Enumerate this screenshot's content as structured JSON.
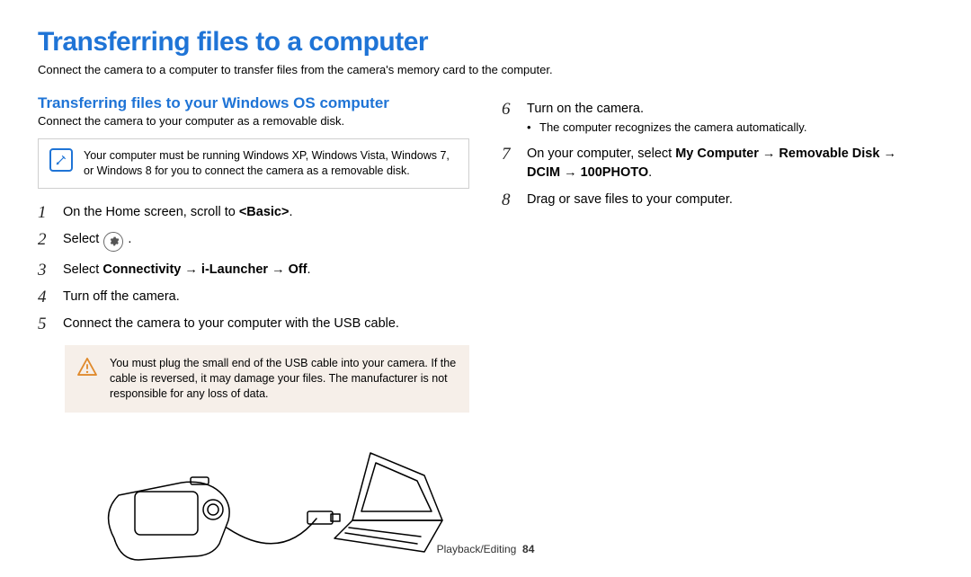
{
  "title": "Transferring files to a computer",
  "intro": "Connect the camera to a computer to transfer files from the camera's memory card to the computer.",
  "section_heading": "Transferring files to your Windows OS computer",
  "section_sub": "Connect the camera to your computer as a removable disk.",
  "note": "Your computer must be running Windows XP, Windows Vista, Windows 7, or Windows 8 for you to connect the camera as a removable disk.",
  "steps": {
    "s1_pre": "On the Home screen, scroll to ",
    "s1_bold": "<Basic>",
    "s1_post": ".",
    "s2_pre": "Select ",
    "s2_post": " .",
    "s3_pre": "Select ",
    "s3_bold": "Connectivity → i-Launcher → Off",
    "s3_post": ".",
    "s4": "Turn off the camera.",
    "s5": "Connect the camera to your computer with the USB cable.",
    "s6": "Turn on the camera.",
    "s6_bullet": "The computer recognizes the camera automatically.",
    "s7_pre": "On your computer, select ",
    "s7_bold": "My Computer → Removable Disk → DCIM → 100PHOTO",
    "s7_post": ".",
    "s8": "Drag or save files to your computer."
  },
  "warning": "You must plug the small end of the USB cable into your camera. If the cable is reversed, it may damage your files. The manufacturer is not responsible for any loss of data.",
  "footer_section": "Playback/Editing",
  "footer_page": "84"
}
